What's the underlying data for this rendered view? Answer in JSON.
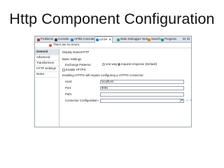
{
  "slide": {
    "title": "Http Component Configuration"
  },
  "tabs": [
    {
      "label": "Problems",
      "color": "#c0392b"
    },
    {
      "label": "Console",
      "color": "#34495e"
    },
    {
      "label": "APIkit Consoles",
      "color": "#2e86c1"
    },
    {
      "label": "HTTP",
      "color": "#2e86c1",
      "active": true
    },
    {
      "label": "Mule Debugger View",
      "color": "#27ae60"
    },
    {
      "label": "Search",
      "color": "#e67e22"
    },
    {
      "label": "Progress",
      "color": "#16a085"
    }
  ],
  "info": {
    "message": "There are no errors."
  },
  "nav": [
    {
      "label": "General"
    },
    {
      "label": "Advanced"
    },
    {
      "label": "Transformers"
    },
    {
      "label": "HTTP Settings"
    },
    {
      "label": "Notes"
    }
  ],
  "form": {
    "display_name_label": "Display Name:",
    "display_name_value": "HTTP",
    "basic_settings": "Basic Settings",
    "exchange_patterns_label": "Exchange Patterns:",
    "pattern_one_way": "one-way",
    "pattern_request_response": "request-response (Default)",
    "enable_https_label": "Enable HTTPS",
    "https_note": "Enabling HTTPS will require configuring a HTTPS Connector.",
    "host_label": "Host:",
    "host_value": "localhost",
    "port_label": "Port:",
    "port_value": "8081",
    "path_label": "Path:",
    "path_value": "",
    "connector_label": "Connector Configuration:",
    "connector_value": ""
  }
}
